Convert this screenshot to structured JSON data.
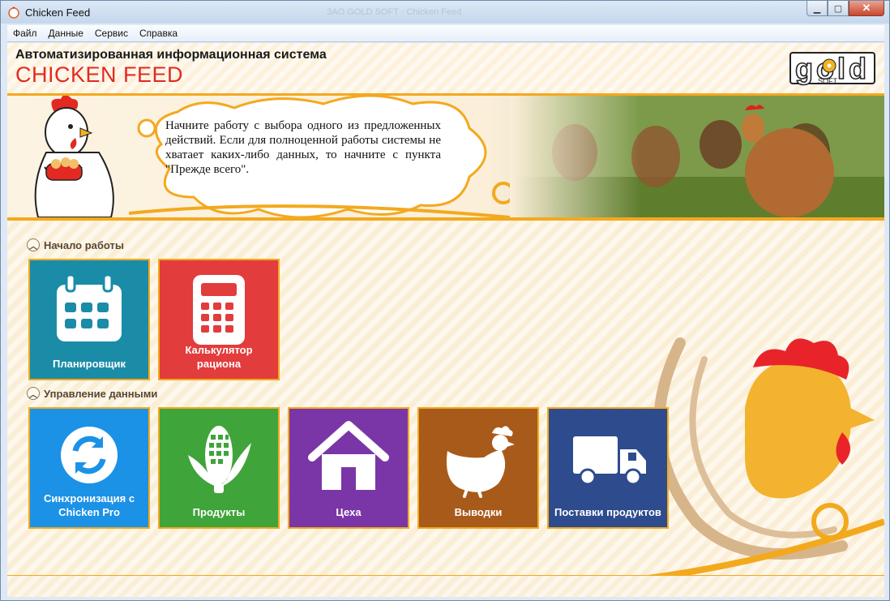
{
  "window": {
    "title": "Chicken Feed",
    "ghost_title": "ЗАО GOLD SOFT · Chicken Feed",
    "controls": {
      "minimize": "▁",
      "maximize": "▢",
      "close": "✕"
    }
  },
  "menu": [
    "Файл",
    "Данные",
    "Сервис",
    "Справка"
  ],
  "header": {
    "subtitle": "Автоматизированная информационная система",
    "app_title": "CHICKEN FEED",
    "logo_text": "gold",
    "logo_sub": "SOFT"
  },
  "banner": {
    "message": "Начните работу с выбора одного из предложенных действий. Если для полноценной работы системы не хватает каких-либо данных, то начните с пункта \"Прежде всего\"."
  },
  "sections": [
    {
      "title": "Начало работы",
      "tiles": [
        {
          "label": "Планировщик",
          "icon": "calendar-icon",
          "color": "#1a8ca8"
        },
        {
          "label": "Калькулятор рациона",
          "icon": "calculator-icon",
          "color": "#e23c3c"
        }
      ]
    },
    {
      "title": "Управление данными",
      "tiles": [
        {
          "label": "Синхронизация с Chicken Pro",
          "icon": "sync-icon",
          "color": "#1c92e6"
        },
        {
          "label": "Продукты",
          "icon": "corn-icon",
          "color": "#3fa43a"
        },
        {
          "label": "Цеха",
          "icon": "house-icon",
          "color": "#7a36a6"
        },
        {
          "label": "Выводки",
          "icon": "hen-icon",
          "color": "#a85a1a"
        },
        {
          "label": "Поставки продуктов",
          "icon": "truck-icon",
          "color": "#2e4b8e"
        }
      ]
    }
  ],
  "colors": {
    "accent": "#f3a91e",
    "title_red": "#e32a22"
  }
}
